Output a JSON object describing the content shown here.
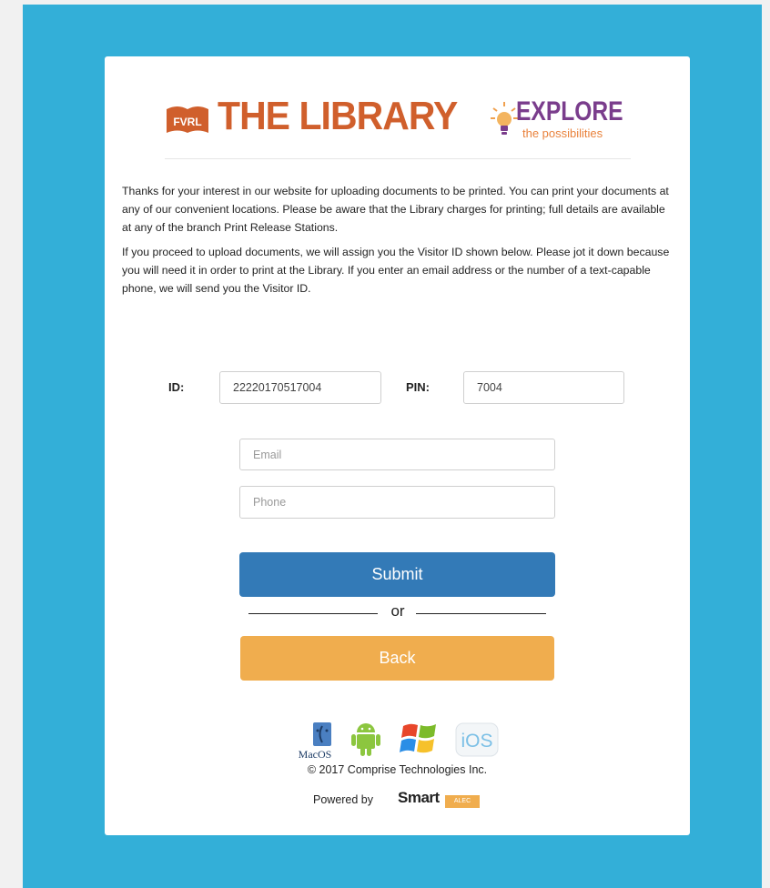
{
  "header": {
    "brand_badge": "FVRL",
    "brand_title": "THE LIBRARY",
    "explore": "EXPLORE",
    "tagline": "the possibilities"
  },
  "intro": {
    "paragraph1": "Thanks for your interest in our website for uploading documents to be printed. You can print your documents at any of our convenient locations. Please be aware that the Library charges for printing; full details are available at any of the branch Print Release Stations.",
    "paragraph2": "If you proceed to upload documents, we will assign you the Visitor ID shown below. Please jot it down because you will need it in order to print at the Library. If you enter an email address or the number of a text-capable phone, we will send you the Visitor ID."
  },
  "credentials": {
    "id_label": "ID:",
    "id_value": "22220170517004",
    "pin_label": "PIN:",
    "pin_value": "7004"
  },
  "contact": {
    "email_placeholder": "Email",
    "phone_placeholder": "Phone"
  },
  "actions": {
    "submit_label": "Submit",
    "or_label": "or",
    "back_label": "Back"
  },
  "platforms": {
    "macos_label": "MacOS",
    "ios_label": "iOS"
  },
  "footer": {
    "copyright": "© 2017 Comprise Technologies Inc.",
    "powered_by": "Powered by",
    "smart_logo": "Smart",
    "smart_badge": "ALEC"
  },
  "colors": {
    "background_blue": "#33afd8",
    "brand_orange": "#d05f2c",
    "explore_purple": "#7a3d8c",
    "submit_blue": "#337ab7",
    "back_orange": "#f0ad4e"
  }
}
